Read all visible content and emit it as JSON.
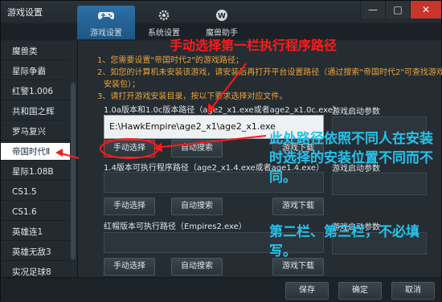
{
  "window": {
    "title": "游戏设置",
    "min": "—",
    "max": "□",
    "close": "✕"
  },
  "tabs": [
    {
      "label": "游戏设置",
      "icon": "gamepad-icon"
    },
    {
      "label": "系统设置",
      "icon": "gear-icon"
    },
    {
      "label": "魔兽助手",
      "icon": "helper-icon"
    }
  ],
  "sidebar": [
    "魔兽类",
    "星际争霸",
    "红警1.006",
    "共和国之辉",
    "罗马复兴",
    "帝国时代Ⅱ",
    "星际1.08B",
    "CS1.5",
    "CS1.6",
    "英雄连1",
    "英雄无敌3",
    "实况足球8"
  ],
  "hints": [
    "1、您需要设置\"帝国时代2\"的游戏路径；",
    "2、如您的计算机未安装该游戏，请安装后再打开平台设置路径（通过搜索\"帝国时代2\"可查找游戏",
    "安装包）；",
    "3、请打开游戏安装目录，按以下要求选择对应文件。"
  ],
  "section1": {
    "label": "1.0a版本和1.0c版本路径（age2_x1.exe或者age2_x1.0c.exe）",
    "value": "E:\\HawkEmpire\\age2_x1\\age2_x1.exe"
  },
  "section2": {
    "label": "1.4版本可执行程序路径（age2_x1.4.exe或者age1.4.exe）"
  },
  "section3": {
    "label": "红帽版本可执行路径（Empires2.exe）"
  },
  "buttons": {
    "manual": "手动选择",
    "auto": "自动搜索",
    "download": "游戏下载"
  },
  "right": {
    "launch_params": "游戏启动参数"
  },
  "footer": {
    "save": "保存",
    "ok": "确定",
    "cancel": "取消"
  },
  "annotations": {
    "top": "手动选择第一栏执行程序路径",
    "middle": "此处路径依照不同人在安装时选择的安装位置不同而不同。",
    "bottom": "第二栏、第三栏，不必填写。"
  },
  "colors": {
    "accent": "#2d6fa6",
    "hint": "#e8a23b",
    "annotation_red": "#ff1a1a",
    "annotation_cyan": "#25c3ec"
  }
}
